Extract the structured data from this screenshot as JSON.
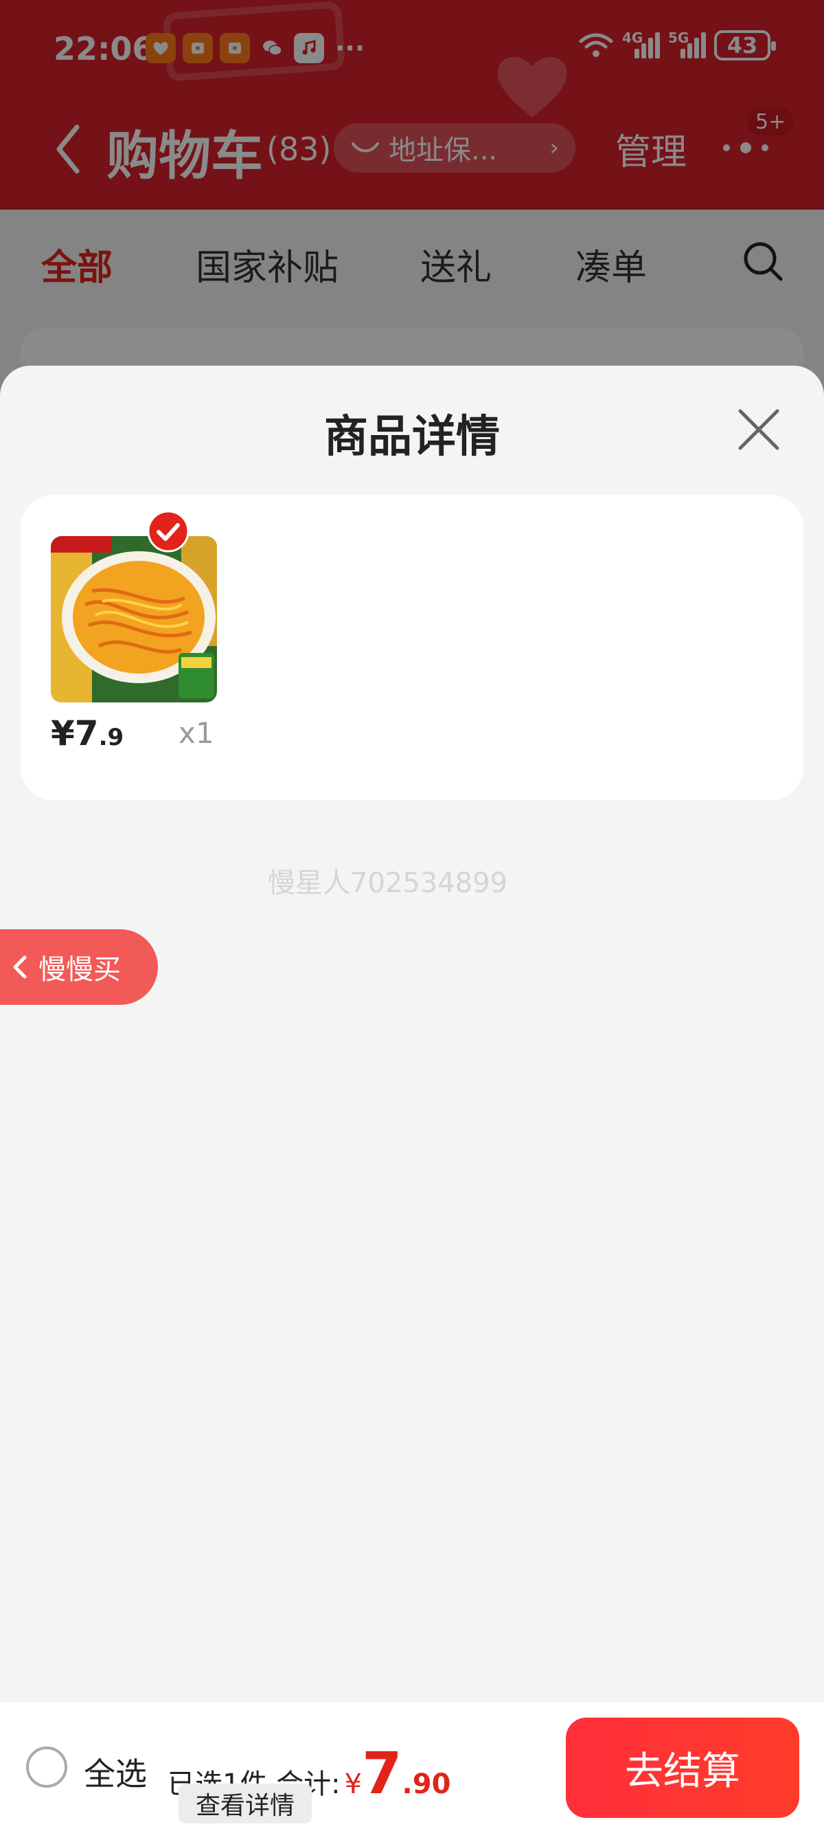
{
  "status": {
    "time": "22:06",
    "net1": "4G",
    "net2": "5G",
    "battery": "43"
  },
  "header": {
    "title": "购物车",
    "count": "(83)",
    "address": "地址保...",
    "manage": "管理",
    "badge": "5+"
  },
  "tabs": [
    "全部",
    "国家补贴",
    "送礼",
    "凑单"
  ],
  "sheet": {
    "title": "商品详情",
    "item": {
      "price_int": "¥7",
      "price_dec": ".9",
      "qty": "x1"
    },
    "watermark": "慢星人702534899"
  },
  "slow_buy": "慢慢买",
  "bottom": {
    "select_all": "全选",
    "selected_text": "已选1件,合计:",
    "currency": "¥",
    "total_int": "7",
    "total_dec": ".90",
    "details": "查看详情",
    "checkout": "去结算"
  },
  "colors": {
    "accent": "#e2231a",
    "header_bg": "#d8222c"
  }
}
